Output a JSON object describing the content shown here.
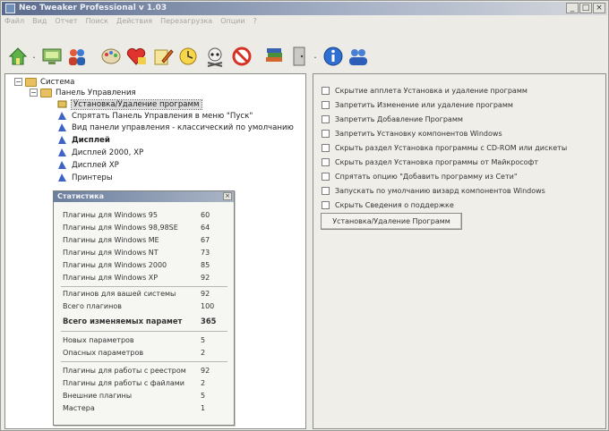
{
  "window": {
    "title": "Neo Tweaker Professional v 1.03"
  },
  "menu": [
    "Файл",
    "Вид",
    "Отчет",
    "Поиск",
    "Действия",
    "Перезагрузка",
    "Опции",
    "?"
  ],
  "toolbar_icons": [
    "home-icon",
    "computer-icon",
    "users-icon",
    "palette-icon",
    "heart-icon",
    "pencil-icon",
    "clock-icon",
    "skull-icon",
    "forbidden-icon",
    "books-icon",
    "door-icon",
    "info-icon",
    "people-icon"
  ],
  "tree": {
    "root": "Система",
    "panel": "Панель Управления",
    "items": [
      "Установка/Удаление программ",
      "Спрятать Панель Управления в меню \"Пуск\"",
      "Вид панели управления - классический по умолчанию",
      "Дисплей",
      "Дисплей 2000, XP",
      "Дисплей XP",
      "Принтеры"
    ]
  },
  "stats": {
    "title": "Статистика",
    "group1": [
      {
        "label": "Плагины для Windows 95",
        "value": "60"
      },
      {
        "label": "Плагины для Windows 98,98SE",
        "value": "64"
      },
      {
        "label": "Плагины для Windows ME",
        "value": "67"
      },
      {
        "label": "Плагины для Windows NT",
        "value": "73"
      },
      {
        "label": "Плагины для Windows 2000",
        "value": "85"
      },
      {
        "label": "Плагины для Windows XP",
        "value": "92"
      }
    ],
    "group2": [
      {
        "label": "Плагинов для вашей системы",
        "value": "92"
      },
      {
        "label": "Всего плагинов",
        "value": "100"
      }
    ],
    "total": {
      "label": "Всего изменяемых парамет",
      "value": "365"
    },
    "group3": [
      {
        "label": "Новых параметров",
        "value": "5"
      },
      {
        "label": "Опасных параметров",
        "value": "2"
      }
    ],
    "group4": [
      {
        "label": "Плагины для работы с реестром",
        "value": "92"
      },
      {
        "label": "Плагины для работы с файлами",
        "value": "2"
      },
      {
        "label": "Внешние плагины",
        "value": "5"
      },
      {
        "label": "Мастера",
        "value": "1"
      }
    ]
  },
  "options": [
    "Скрытие апплета Установка и удаление программ",
    "Запретить Изменение или удаление программ",
    "Запретить Добавление Программ",
    "Запретить Установку компонентов Windows",
    "Скрыть раздел Установка программы с CD-ROM или дискеты",
    "Скрыть раздел Установка программы от Майкрософт",
    "Спрятать опцию \"Добавить программу из Сети\"",
    "Запускать по умолчанию визард компонентов Windows",
    "Скрыть Сведения о поддержке"
  ],
  "action_button": "Установка/Удаление Программ",
  "colors": {
    "titlebar_start": "#5a6b8e",
    "selection": "#dcdcdc",
    "folder": "#e8c060"
  }
}
